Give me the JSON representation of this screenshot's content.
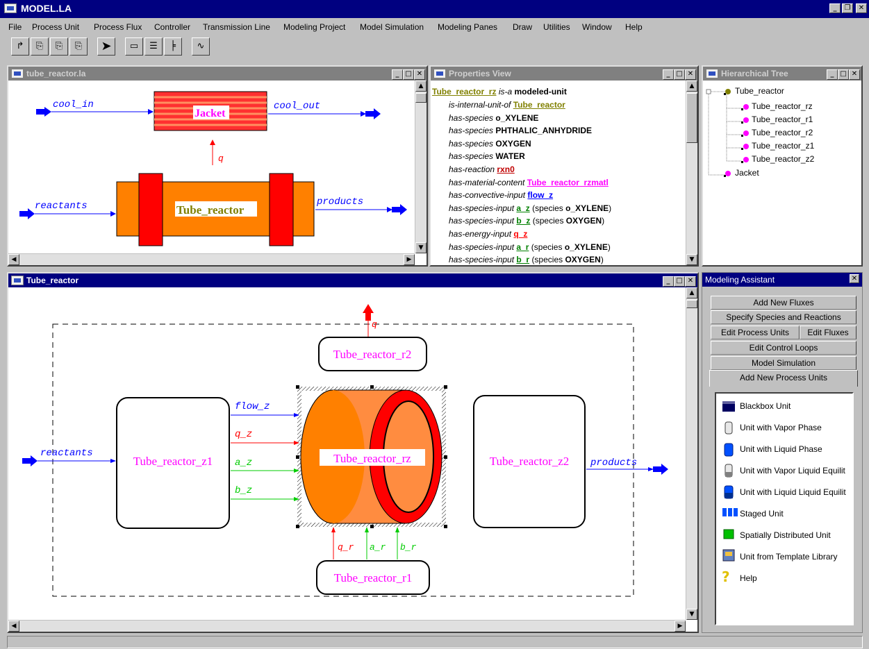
{
  "app": {
    "title": "MODEL.LA"
  },
  "menu": [
    "File",
    "Process Unit",
    "Process Flux",
    "Controller",
    "Transmission Line",
    "Modeling Project",
    "Model Simulation",
    "Modeling Panes",
    "Draw",
    "Utilities",
    "Window",
    "Help"
  ],
  "reactor_window": {
    "title": "tube_reactor.la",
    "labels": {
      "cool_in": "cool_in",
      "cool_out": "cool_out",
      "jacket": "Jacket",
      "q": "q",
      "reactants": "reactants",
      "products": "products",
      "tube_reactor": "Tube_reactor"
    }
  },
  "properties": {
    "title": "Properties View",
    "header": {
      "subject": "Tube_reactor_rz",
      "relation": "is-a",
      "object": "modeled-unit"
    },
    "rows": [
      {
        "rel": "is-internal-unit-of",
        "val": "Tube_reactor",
        "style": "olive",
        "extra": ""
      },
      {
        "rel": "has-species",
        "val": "o_XYLENE",
        "style": "plain",
        "extra": ""
      },
      {
        "rel": "has-species",
        "val": "PHTHALIC_ANHYDRIDE",
        "style": "plain",
        "extra": ""
      },
      {
        "rel": "has-species",
        "val": "OXYGEN",
        "style": "plain",
        "extra": ""
      },
      {
        "rel": "has-species",
        "val": "WATER",
        "style": "plain",
        "extra": ""
      },
      {
        "rel": "has-reaction",
        "val": "rxn0",
        "style": "red",
        "extra": ""
      },
      {
        "rel": "has-material-content",
        "val": "Tube_reactor_rzmatl",
        "style": "magenta",
        "extra": ""
      },
      {
        "rel": "has-convective-input",
        "val": "flow_z",
        "style": "blue",
        "extra": ""
      },
      {
        "rel": "has-species-input",
        "val": "a_z",
        "style": "green",
        "extra_pre": "(species ",
        "extra": "o_XYLENE",
        "extra_post": ")"
      },
      {
        "rel": "has-species-input",
        "val": "b_z",
        "style": "green",
        "extra_pre": "(species ",
        "extra": "OXYGEN",
        "extra_post": ")"
      },
      {
        "rel": "has-energy-input",
        "val": "q_z",
        "style": "redn",
        "extra": ""
      },
      {
        "rel": "has-species-input",
        "val": "a_r",
        "style": "green",
        "extra_pre": "(species ",
        "extra": "o_XYLENE",
        "extra_post": ")"
      },
      {
        "rel": "has-species-input",
        "val": "b_r",
        "style": "green",
        "extra_pre": "(species ",
        "extra": "OXYGEN",
        "extra_post": ")"
      }
    ]
  },
  "tree": {
    "title": "Hierarchical Tree",
    "root": "Tube_reactor",
    "children": [
      "Tube_reactor_rz",
      "Tube_reactor_r1",
      "Tube_reactor_r2",
      "Tube_reactor_z1",
      "Tube_reactor_z2"
    ],
    "sibling": "Jacket"
  },
  "diagram": {
    "title": "Tube_reactor",
    "units": {
      "r2": "Tube_reactor_r2",
      "z1": "Tube_reactor_z1",
      "rz": "Tube_reactor_rz",
      "z2": "Tube_reactor_z2",
      "r1": "Tube_reactor_r1"
    },
    "flows": {
      "q": "q",
      "reactants": "reactants",
      "products": "products",
      "flow_z": "flow_z",
      "q_z": "q_z",
      "a_z": "a_z",
      "b_z": "b_z",
      "q_r": "q_r",
      "a_r": "a_r",
      "b_r": "b_r"
    }
  },
  "assistant": {
    "title": "Modeling Assistant",
    "tabs": {
      "add_fluxes": "Add New Fluxes",
      "species": "Specify Species and Reactions",
      "edit_units": "Edit Process Units",
      "edit_fluxes": "Edit Fluxes",
      "control": "Edit Control Loops",
      "simulation": "Model Simulation",
      "add_units": "Add New Process Units"
    },
    "items": [
      {
        "label": "Blackbox Unit",
        "icon": "blackbox-icon"
      },
      {
        "label": "Unit with Vapor Phase",
        "icon": "vapor-phase-icon"
      },
      {
        "label": "Unit with Liquid Phase",
        "icon": "liquid-phase-icon"
      },
      {
        "label": "Unit with Vapor Liquid Equilit",
        "icon": "vapor-liquid-icon"
      },
      {
        "label": "Unit with Liquid Liquid Equilit",
        "icon": "liquid-liquid-icon"
      },
      {
        "label": "Staged Unit",
        "icon": "staged-unit-icon"
      },
      {
        "label": "Spatially Distributed Unit",
        "icon": "spatial-unit-icon"
      },
      {
        "label": "Unit from Template Library",
        "icon": "template-library-icon"
      },
      {
        "label": "Help",
        "icon": "help-icon"
      }
    ]
  },
  "colors": {
    "title_active": "#000080",
    "title_inactive": "#808080",
    "flow_blue": "#0000ff",
    "energy_red": "#ff0000",
    "species_green": "#00cc00",
    "unit_magenta": "#ff00ff",
    "reactor_orange": "#ff8000"
  }
}
